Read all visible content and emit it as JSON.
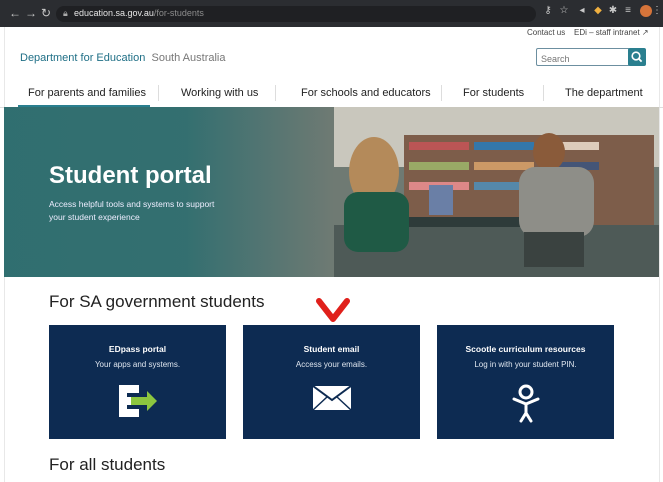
{
  "browser": {
    "url_domain": "education.sa.gov.au",
    "url_path": "/for-students",
    "back_icon": "arrow-left-icon",
    "forward_icon": "arrow-right-icon",
    "reload_icon": "reload-icon"
  },
  "utility": {
    "contact": "Contact us",
    "intranet": "EDi – staff intranet"
  },
  "header": {
    "brand": "Department for Education",
    "brand_sub": "South Australia",
    "search_placeholder": "Search"
  },
  "nav": {
    "items": [
      {
        "label": "For parents and families"
      },
      {
        "label": "Working with us"
      },
      {
        "label": "For schools and educators"
      },
      {
        "label": "For students"
      },
      {
        "label": "The department"
      }
    ]
  },
  "hero": {
    "title": "Student portal",
    "subtitle": "Access helpful tools and systems to support your student experience"
  },
  "sections": {
    "gov_title": "For SA government students",
    "all_title": "For all students"
  },
  "cards": [
    {
      "title": "EDpass portal",
      "desc": "Your apps and systems.",
      "icon": "edpass-logo-icon"
    },
    {
      "title": "Student email",
      "desc": "Access your emails.",
      "icon": "envelope-icon"
    },
    {
      "title": "Scootle curriculum resources",
      "desc": "Log in with your student PIN.",
      "icon": "person-icon"
    }
  ],
  "colors": {
    "card_bg": "#0d2b52",
    "accent": "#2a7f8f",
    "annotation": "#e0201b"
  }
}
